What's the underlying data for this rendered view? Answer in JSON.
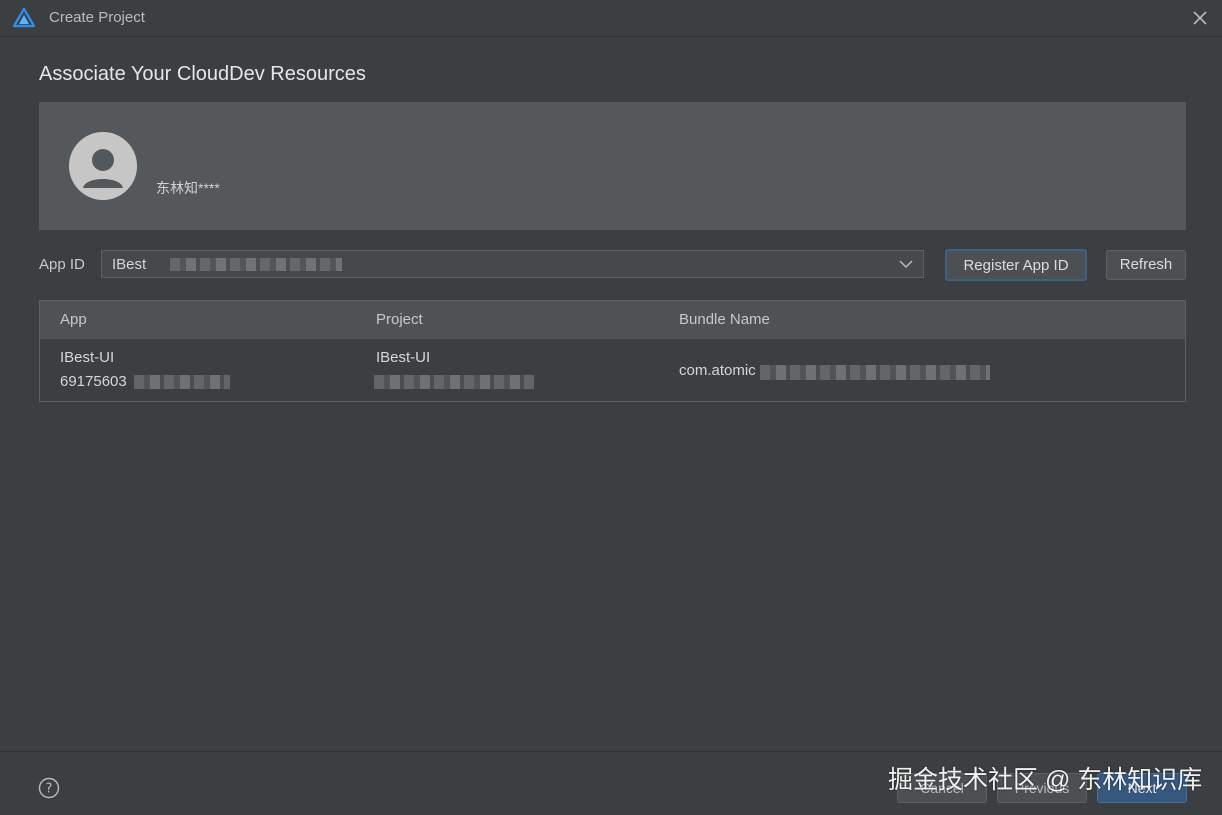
{
  "window": {
    "title": "Create Project",
    "heading": "Associate Your CloudDev Resources"
  },
  "account": {
    "username": "东林知****"
  },
  "app_id": {
    "label": "App ID",
    "selected_value": "IBest"
  },
  "buttons": {
    "register": "Register App ID",
    "refresh": "Refresh",
    "cancel": "Cancel",
    "previous": "Previous",
    "next": "Next"
  },
  "table": {
    "columns": [
      "App",
      "Project",
      "Bundle Name"
    ],
    "rows": [
      {
        "app_name": "IBest-UI",
        "app_id": "69175603",
        "project": "IBest-UI",
        "bundle": "com.atomic"
      }
    ]
  },
  "watermark": "掘金技术社区 @ 东林知识库",
  "colors": {
    "background": "#3c3f41",
    "panel": "#55585a",
    "accent_border": "#3d6185",
    "primary_button": "#365880"
  },
  "icons": {
    "logo": "deveco-logo-icon",
    "close": "close-icon",
    "avatar": "user-avatar-icon",
    "chevron": "chevron-down-icon",
    "help": "help-icon"
  }
}
